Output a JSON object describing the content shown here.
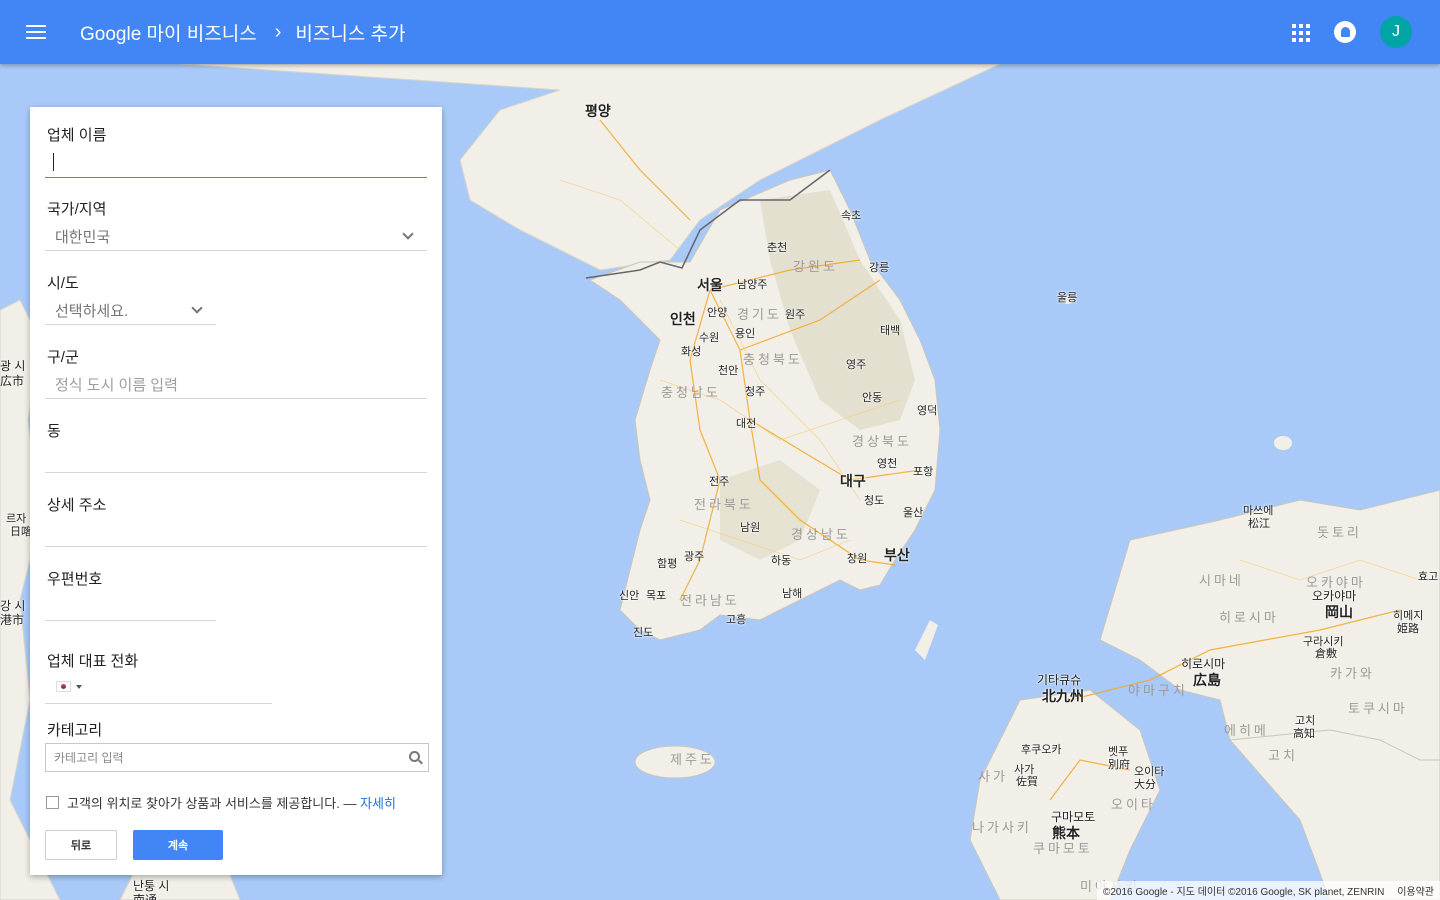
{
  "header": {
    "breadcrumb": [
      "Google 마이 비즈니스",
      "비즈니스 추가"
    ],
    "avatar_initial": "J",
    "icons": [
      "menu-icon",
      "apps-icon",
      "notifications-icon"
    ],
    "accent_color": "#4285f4"
  },
  "form": {
    "business_name": {
      "label": "업체 이름",
      "value": ""
    },
    "country": {
      "label": "국가/지역",
      "value": "대한민국"
    },
    "province": {
      "label": "시/도",
      "value": "선택하세요."
    },
    "district": {
      "label": "구/군",
      "placeholder": "정식 도시 이름 입력"
    },
    "dong": {
      "label": "동",
      "value": ""
    },
    "address": {
      "label": "상세 주소",
      "value": ""
    },
    "postal": {
      "label": "우편번호",
      "value": ""
    },
    "phone": {
      "label": "업체 대표 전화",
      "value": ""
    },
    "category": {
      "label": "카테고리",
      "placeholder": "카테고리 입력"
    },
    "delivery_checkbox": {
      "text": "고객의 위치로 찾아가 상품과 서비스를 제공합니다. —",
      "link": "자세히",
      "checked": false
    },
    "back_button": "뒤로",
    "continue_button": "계속"
  },
  "map": {
    "labels": {
      "pyongyang": "평양",
      "seoul": "서울",
      "incheon": "인천",
      "chuncheon": "춘천",
      "sokcho": "속초",
      "gangneung": "강릉",
      "ulleung": "울릉",
      "namyangju": "남양주",
      "anyang": "안양",
      "suwon": "수원",
      "yongin": "용인",
      "wonju": "원주",
      "hwaseong": "화성",
      "cheonan": "천안",
      "cheongju": "청주",
      "taebaek": "태백",
      "yeongju": "영주",
      "andong": "안동",
      "yeongdeok": "영덕",
      "daejeon": "대전",
      "pohang": "포항",
      "yeongcheon": "영천",
      "daegu": "대구",
      "jeonju": "전주",
      "cheongdo": "청도",
      "ulsan": "울산",
      "namwon": "남원",
      "busan": "부산",
      "gwangju": "광주",
      "hampyeong": "함평",
      "hadong": "하동",
      "changwon": "창원",
      "mokpo": "목포",
      "sinan": "신안",
      "namhae": "남해",
      "jindo": "진도",
      "goheung": "고흥",
      "gangwon": "강원도",
      "gyeonggi": "경기도",
      "chungbuk": "충청북도",
      "chungnam": "충청남도",
      "gyeongbuk": "경상북도",
      "jeonbuk": "전라북도",
      "gyeongnam": "경상남도",
      "jeonnam": "전라남도",
      "jeju": "제주도",
      "matsue_ko": "마쓰에",
      "matsue": "松江",
      "tottori": "돗토리",
      "shimane": "시마네",
      "okayama_ko1": "오카야마",
      "okayama_ko2": "오카야마",
      "okayama": "岡山",
      "himeji_ko": "히메지",
      "himeji": "姫路",
      "hiroshima_ko1": "히로시마",
      "kurashiki_ko": "구라시키",
      "kurashiki": "倉敷",
      "hiroshima_ko2": "히로시마",
      "hiroshima": "広島",
      "kagawa": "카가와",
      "kitakyushu_ko": "기타큐슈",
      "kitakyushu": "北九州",
      "yamaguchi": "야마구치",
      "ehime": "에히메",
      "kochi_ko1": "고치",
      "kochi": "高知",
      "kochi_ko2": "고치",
      "tokushima": "토쿠시마",
      "fukuoka": "후쿠오카",
      "beppu_ko": "벳푸",
      "beppu": "別府",
      "saga_ko1": "사가",
      "saga": "佐賀",
      "saga_ko2": "사가",
      "oita_ko1": "오이타",
      "oita": "大分",
      "oita_ko2": "오이타",
      "kumamoto_ko": "구마모토",
      "kumamoto": "熊本",
      "nagasaki": "나가사키",
      "kumamoto_ko2": "쿠마모토",
      "miyazaki": "미야자키",
      "hyogo": "효고",
      "left_a": "광 시",
      "left_b": "広市",
      "left_c": "르자",
      "left_d": "日喀",
      "left_e": "강 시",
      "left_f": "港市",
      "nantong_ko": "난퉁 시",
      "nantong": "南通"
    }
  },
  "attribution": {
    "data": "©2016 Google - 지도 데이터 ©2016 Google, SK planet, ZENRIN",
    "terms": "이용약관"
  }
}
